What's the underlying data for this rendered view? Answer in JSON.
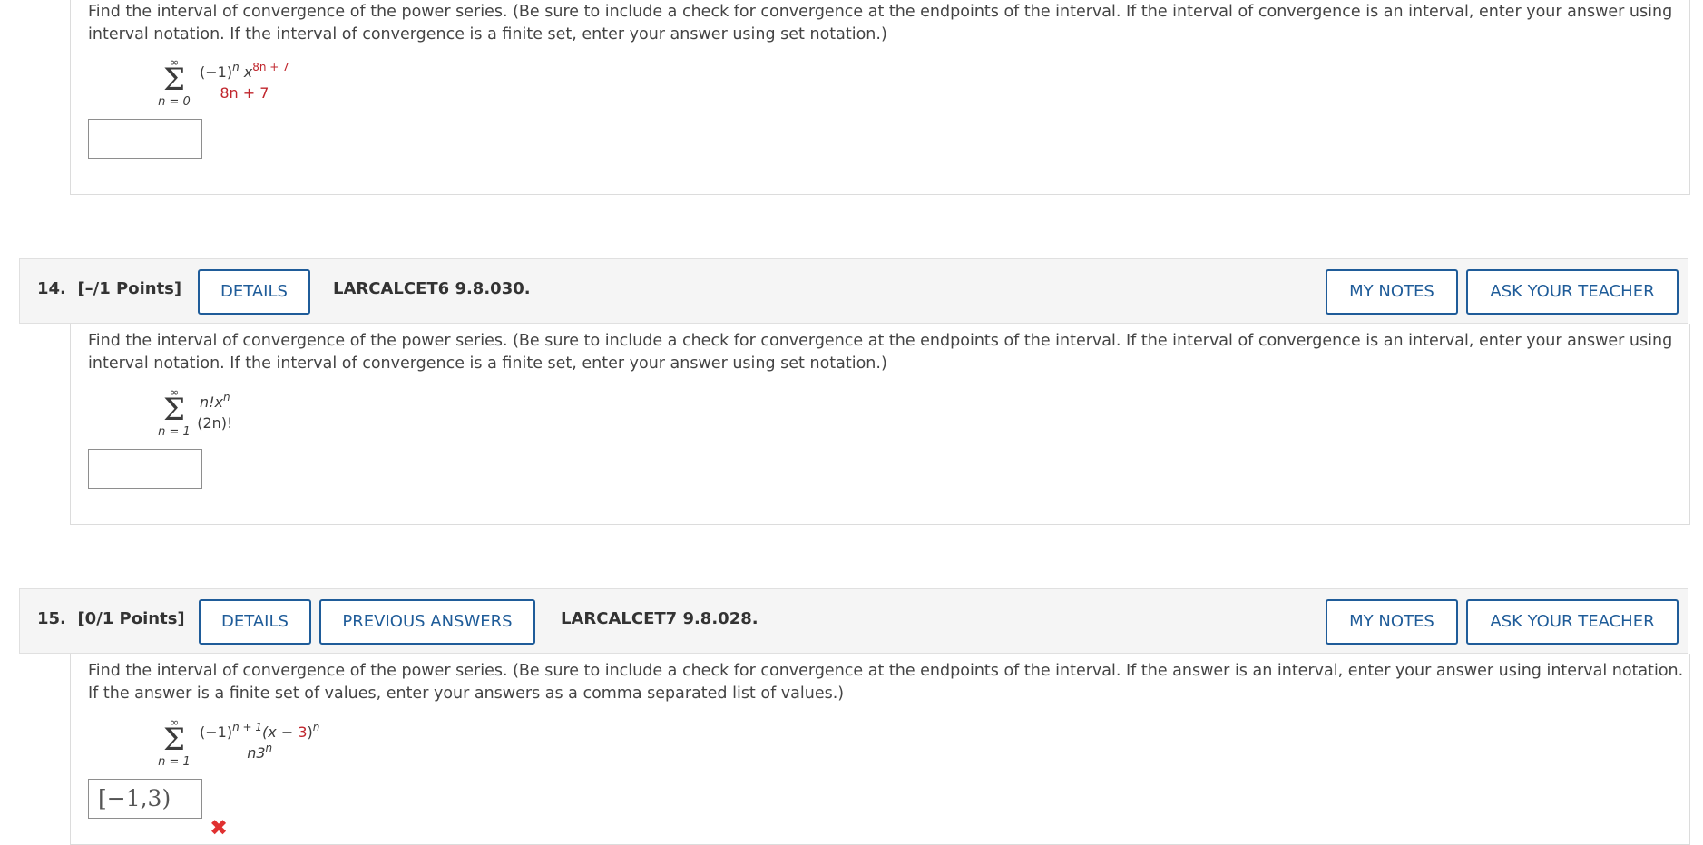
{
  "q13": {
    "prompt": "Find the interval of convergence of the power series. (Be sure to include a check for convergence at the endpoints of the interval. If the interval of convergence is an interval, enter your answer using interval notation. If the interval of convergence is a finite set, enter your answer using set notation.)",
    "series": {
      "upper": "∞",
      "sigma": "Σ",
      "lower": "n = 0",
      "numerator_a": "(−1)",
      "numerator_a_exp": "n",
      "numerator_b": " x",
      "numerator_b_exp": "8n + 7",
      "denominator": "8n + 7"
    },
    "answer": ""
  },
  "q14": {
    "number": "14.",
    "points": "[–/1 Points]",
    "details": "DETAILS",
    "code": "LARCALCET6 9.8.030.",
    "my_notes": "MY NOTES",
    "ask_teacher": "ASK YOUR TEACHER",
    "prompt": "Find the interval of convergence of the power series. (Be sure to include a check for convergence at the endpoints of the interval. If the interval of convergence is an interval, enter your answer using interval notation. If the interval of convergence is a finite set, enter your answer using set notation.)",
    "series": {
      "upper": "∞",
      "sigma": "Σ",
      "lower": "n = 1",
      "numerator": "n!x",
      "numerator_exp": "n",
      "denominator": "(2n)!"
    },
    "answer": ""
  },
  "q15": {
    "number": "15.",
    "points": "[0/1 Points]",
    "details": "DETAILS",
    "previous": "PREVIOUS ANSWERS",
    "code": "LARCALCET7 9.8.028.",
    "my_notes": "MY NOTES",
    "ask_teacher": "ASK YOUR TEACHER",
    "prompt": "Find the interval of convergence of the power series. (Be sure to include a check for convergence at the endpoints of the interval. If the answer is an interval, enter your answer using interval notation. If the answer is a finite set of values, enter your answers as a comma separated list of values.)",
    "series": {
      "upper": "∞",
      "sigma": "Σ",
      "lower": "n = 1",
      "numerator_a": "(−1)",
      "numerator_a_exp": "n + 1",
      "numerator_b": "(x − ",
      "numerator_c": "3",
      "numerator_d": ")",
      "numerator_d_exp": "n",
      "denominator": "n3",
      "denominator_exp": "n"
    },
    "answer": "[−1,3)",
    "status_icon": "incorrect-x-icon",
    "colors": {
      "button": "#1f5c99",
      "incorrect": "#e03131",
      "highlight": "#c0262d"
    }
  }
}
